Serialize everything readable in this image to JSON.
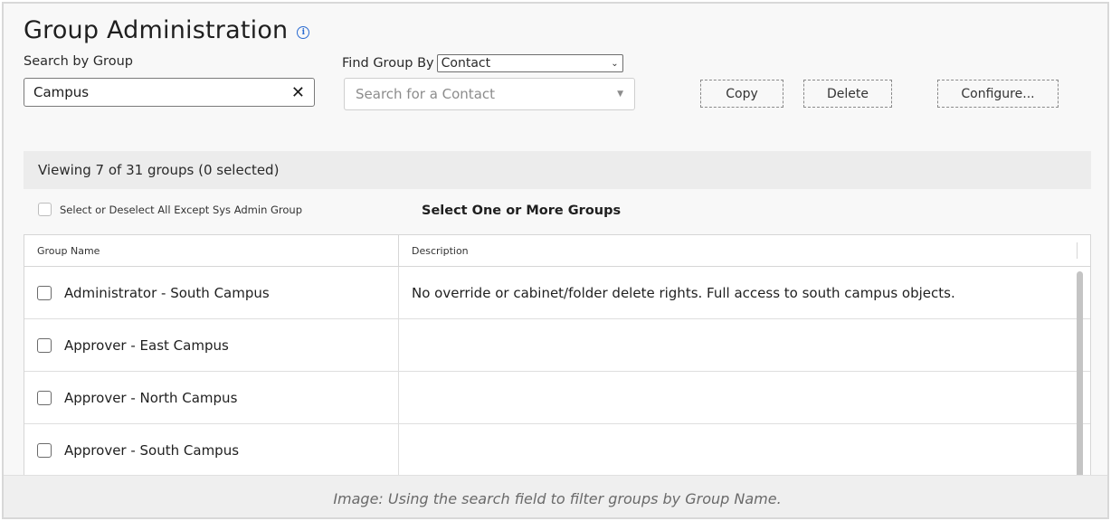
{
  "page": {
    "title": "Group Administration",
    "info_icon": "info-icon"
  },
  "search": {
    "label": "Search by Group",
    "value": "Campus",
    "clear_icon": "close-icon",
    "clear_glyph": "✕"
  },
  "find": {
    "label": "Find Group By",
    "selected": "Contact",
    "chevron_glyph": "⌄",
    "contact_placeholder": "Search for a Contact",
    "caret_glyph": "▼"
  },
  "buttons": {
    "copy": "Copy",
    "delete": "Delete",
    "configure": "Configure..."
  },
  "status": {
    "viewing": "Viewing 7 of 31 groups (0 selected)"
  },
  "select_all": {
    "label": "Select or Deselect All Except Sys Admin Group",
    "checked": false
  },
  "select_heading": "Select One or More Groups",
  "table": {
    "columns": [
      "Group Name",
      "Description"
    ],
    "rows": [
      {
        "name": "Administrator - South Campus",
        "description": "No override or cabinet/folder delete rights. Full access to south campus objects.",
        "checked": false
      },
      {
        "name": "Approver - East Campus",
        "description": "",
        "checked": false
      },
      {
        "name": "Approver - North Campus",
        "description": "",
        "checked": false
      },
      {
        "name": "Approver - South Campus",
        "description": "",
        "checked": false
      }
    ]
  },
  "caption": "Image: Using the search field to filter groups by Group Name.",
  "colors": {
    "accent": "#2a6bd1",
    "panel": "#f8f8f8",
    "status_bar": "#ececec"
  }
}
